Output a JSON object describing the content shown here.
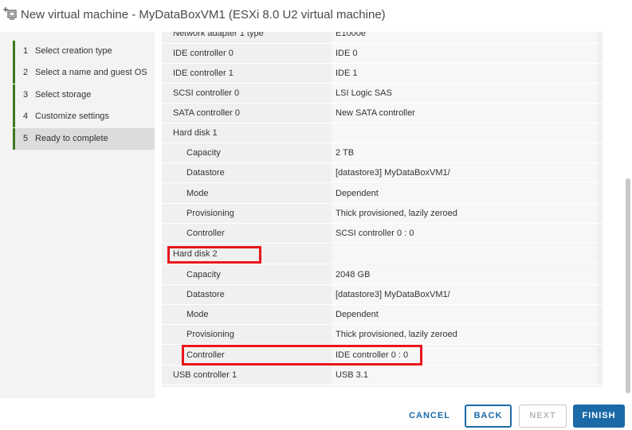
{
  "window": {
    "title": "New virtual machine - MyDataBoxVM1 (ESXi 8.0 U2 virtual machine)",
    "icon": "new-vm-icon"
  },
  "steps": [
    {
      "num": "1",
      "label": "Select creation type",
      "state": "done"
    },
    {
      "num": "2",
      "label": "Select a name and guest OS",
      "state": "done"
    },
    {
      "num": "3",
      "label": "Select storage",
      "state": "done"
    },
    {
      "num": "4",
      "label": "Customize settings",
      "state": "done"
    },
    {
      "num": "5",
      "label": "Ready to complete",
      "state": "current"
    }
  ],
  "summary": {
    "partial_row": {
      "key": "Network adapter 1 type",
      "value": "E1000e"
    },
    "rows": [
      {
        "key": "IDE controller 0",
        "value": "IDE 0"
      },
      {
        "key": "IDE controller 1",
        "value": "IDE 1"
      },
      {
        "key": "SCSI controller 0",
        "value": "LSI Logic SAS"
      },
      {
        "key": "SATA controller 0",
        "value": "New SATA controller"
      },
      {
        "key": "Hard disk 1",
        "value": ""
      },
      {
        "key": "Capacity",
        "value": "2 TB"
      },
      {
        "key": "Datastore",
        "value": "[datastore3] MyDataBoxVM1/"
      },
      {
        "key": "Mode",
        "value": "Dependent"
      },
      {
        "key": "Provisioning",
        "value": "Thick provisioned, lazily zeroed"
      },
      {
        "key": "Controller",
        "value": "SCSI controller 0 : 0"
      },
      {
        "key": "Hard disk 2",
        "value": ""
      },
      {
        "key": "Capacity",
        "value": "2048 GB"
      },
      {
        "key": "Datastore",
        "value": "[datastore3] MyDataBoxVM1/"
      },
      {
        "key": "Mode",
        "value": "Dependent"
      },
      {
        "key": "Provisioning",
        "value": "Thick provisioned, lazily zeroed"
      },
      {
        "key": "Controller",
        "value": "IDE controller 0 : 0"
      },
      {
        "key": "USB controller 1",
        "value": "USB 3.1"
      }
    ]
  },
  "buttons": {
    "cancel": "CANCEL",
    "back": "BACK",
    "next": "NEXT",
    "finish": "FINISH"
  },
  "colors": {
    "accent": "#1a6aa8",
    "highlight": "#e8161c",
    "step_done_bar": "#3b7a20"
  }
}
